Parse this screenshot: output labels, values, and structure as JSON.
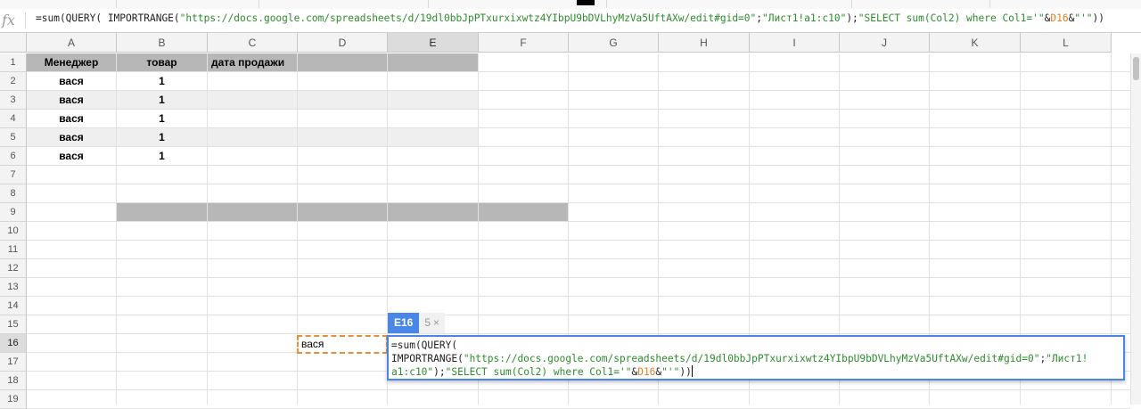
{
  "formula_bar": {
    "fx_label": "fx",
    "formula_prefix": "=sum(QUERY( IMPORTRANGE(",
    "formula_url": "\"https://docs.google.com/spreadsheets/d/19dl0bbJpPTxurxixwtz4YIbpU9bDVLhyMzVa5UftAXw/edit#gid=0\"",
    "formula_sep1": ";",
    "formula_range": "\"Лист1!a1:c10\"",
    "formula_mid": ");",
    "formula_query_a": "\"SELECT sum(Col2) where Col1='\"",
    "formula_amp1": "&",
    "formula_ref": "D16",
    "formula_amp2": "&",
    "formula_query_b": "\"'\"",
    "formula_end": "))"
  },
  "columns": [
    "A",
    "B",
    "C",
    "D",
    "E",
    "F",
    "G",
    "H",
    "I",
    "J",
    "K",
    "L"
  ],
  "selected_column": "E",
  "rows": [
    "1",
    "2",
    "3",
    "4",
    "5",
    "6",
    "7",
    "8",
    "9",
    "10",
    "11",
    "12",
    "13",
    "14",
    "15",
    "16",
    "17",
    "18",
    "19"
  ],
  "selected_row": "16",
  "table": {
    "headers": [
      "Менеджер",
      "товар",
      "дата продажи"
    ],
    "data": [
      [
        "вася",
        "1",
        ""
      ],
      [
        "вася",
        "1",
        ""
      ],
      [
        "вася",
        "1",
        ""
      ],
      [
        "вася",
        "1",
        ""
      ],
      [
        "вася",
        "1",
        ""
      ]
    ]
  },
  "d16_value": "вася",
  "editor": {
    "cell_ref": "E16",
    "preview_value": "5",
    "close_symbol": "×",
    "line1": "=sum(QUERY(",
    "line2_prefix": "IMPORTRANGE(",
    "line2_url": "\"https://docs.google.com/spreadsheets/d/19dl0bbJpPTxurxixwtz4YIbpU9bDVLhyMzVa5UftAXw/edit#gid=0\"",
    "line2_sep": ";",
    "line2_range_a": "\"Лист1!",
    "line3_range_b": "a1:c10\"",
    "line3_mid": ");",
    "line3_query_a": "\"SELECT sum(Col2) where Col1='\"",
    "line3_amp1": "&",
    "line3_ref": "D16",
    "line3_amp2": "&",
    "line3_query_b": "\"'\"",
    "line3_end": "))"
  },
  "colors": {
    "header_fill": "#b7b7b7",
    "band_fill": "#efefef",
    "selection_blue": "#4a86e8",
    "copy_dash_orange": "#e69138",
    "string_green": "#2e8b2e",
    "ref_orange": "#e67c22"
  }
}
